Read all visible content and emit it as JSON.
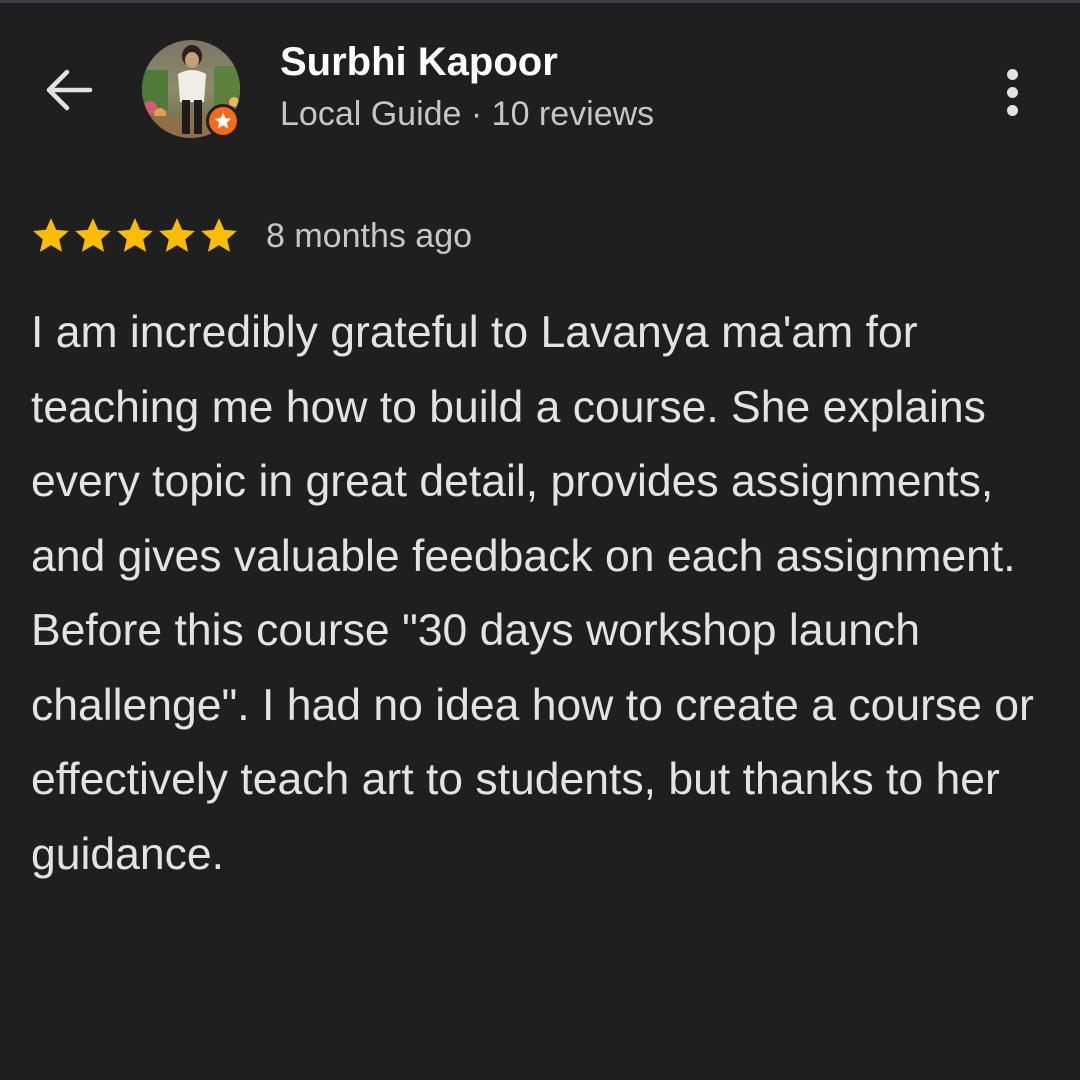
{
  "header": {
    "back_icon": "arrow-left-icon",
    "more_icon": "more-vertical-icon"
  },
  "reviewer": {
    "name": "Surbhi Kapoor",
    "meta": "Local Guide · 10 reviews",
    "badge_icon": "local-guide-star-icon",
    "badge_color": "#f26b1d"
  },
  "review": {
    "rating": 5,
    "rating_max": 5,
    "star_color": "#fbbc04",
    "date": "8 months ago",
    "text": "I am incredibly grateful to Lavanya ma'am for teaching me how to build a course. She explains every topic in great detail, provides assignments, and gives valuable feedback on each assignment. Before this course \"30 days workshop launch challenge\". I had no idea how to create a course or effectively teach art to students, but thanks to her guidance."
  },
  "colors": {
    "background": "#1f1f1f",
    "primary_text": "#e3e3e3",
    "secondary_text": "#c4c7c5"
  }
}
